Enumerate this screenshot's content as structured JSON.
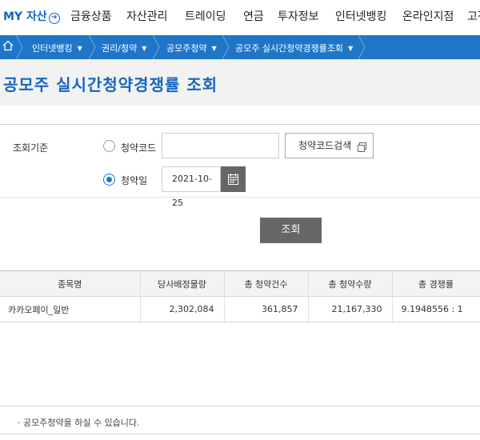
{
  "topnav": {
    "my_label": "MY 자산",
    "my_icon": "arrow-circle-icon",
    "items": [
      "금융상품",
      "자산관리",
      "트레이딩",
      "연금",
      "투자정보",
      "인터넷뱅킹",
      "온라인지점",
      "고객"
    ]
  },
  "breadcrumb": {
    "home_icon": "home-icon",
    "items": [
      "인터넷뱅킹",
      "권리/청약",
      "공모주청약",
      "공모주 실시간청약경쟁률조회"
    ],
    "color": "#1f76c8"
  },
  "page": {
    "title": "공모주 실시간청약경쟁률 조회",
    "title_color": "#1565c0"
  },
  "form": {
    "criteria_label": "조회기준",
    "option_code_label": "청약코드",
    "option_date_label": "청약일",
    "selected": "청약일",
    "code_value": "",
    "code_search_button": "청약코드검색",
    "date_value": "2021-10-25",
    "calendar_icon": "calendar-icon",
    "search_button": "조회"
  },
  "table": {
    "headers": [
      "종목명",
      "당사배정물량",
      "총 청약건수",
      "총 청약수량",
      "총 경쟁률"
    ],
    "rows": [
      [
        "카카오페이_일반",
        "2,302,084",
        "361,857",
        "21,167,330",
        "9.1948556 : 1"
      ]
    ]
  },
  "notice": {
    "text": "· 공모주청약을 하실 수 있습니다."
  }
}
